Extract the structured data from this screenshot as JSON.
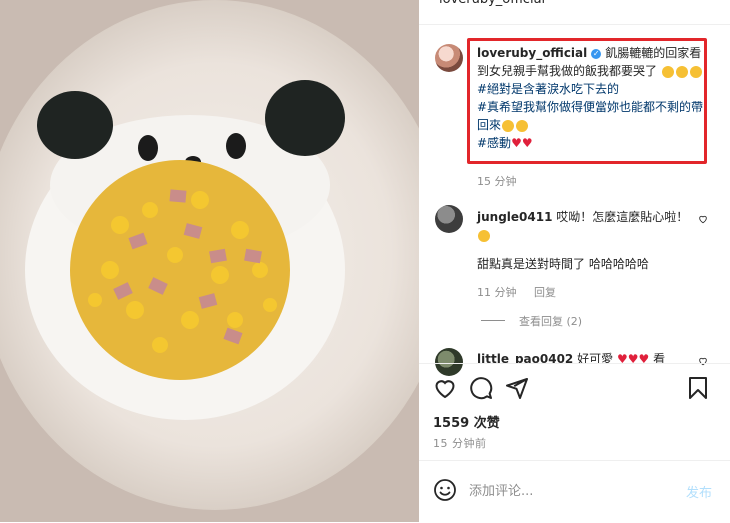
{
  "post": {
    "top_username": "loveruby_official",
    "caption_user": "loveruby_official",
    "caption_text": "飢腸轆轆的回家看到女兒親手幫我做的飯我都要哭了",
    "hashtags": [
      "#絕對是含著淚水吃下去的",
      "#真希望我幫你做得便當妳也能都不剩的帶回來",
      "#感動"
    ],
    "caption_time": "15 分钟"
  },
  "comments": [
    {
      "user": "jungle0411",
      "text": "哎呦！怎麼這麼貼心啦！",
      "reply": "甜點真是送對時間了 哈哈哈哈哈",
      "time": "11 分钟",
      "reply_label": "回复",
      "view_replies": "查看回复 (2)"
    },
    {
      "user": "little_pao0402",
      "text": "好可愛",
      "trailing": "看"
    }
  ],
  "likes": "1559 次赞",
  "posted": "15 分钟前",
  "comment_input": {
    "placeholder": "添加评论..."
  },
  "post_button": "发布",
  "colors": {
    "highlight_box": "#e2262a",
    "hashtag": "#00376b",
    "post_button_disabled": "#b2dffc",
    "verified": "#3897f0"
  },
  "icons": [
    "heart-icon",
    "comment-icon",
    "share-icon",
    "bookmark-icon",
    "emoji-icon",
    "verified-icon"
  ]
}
